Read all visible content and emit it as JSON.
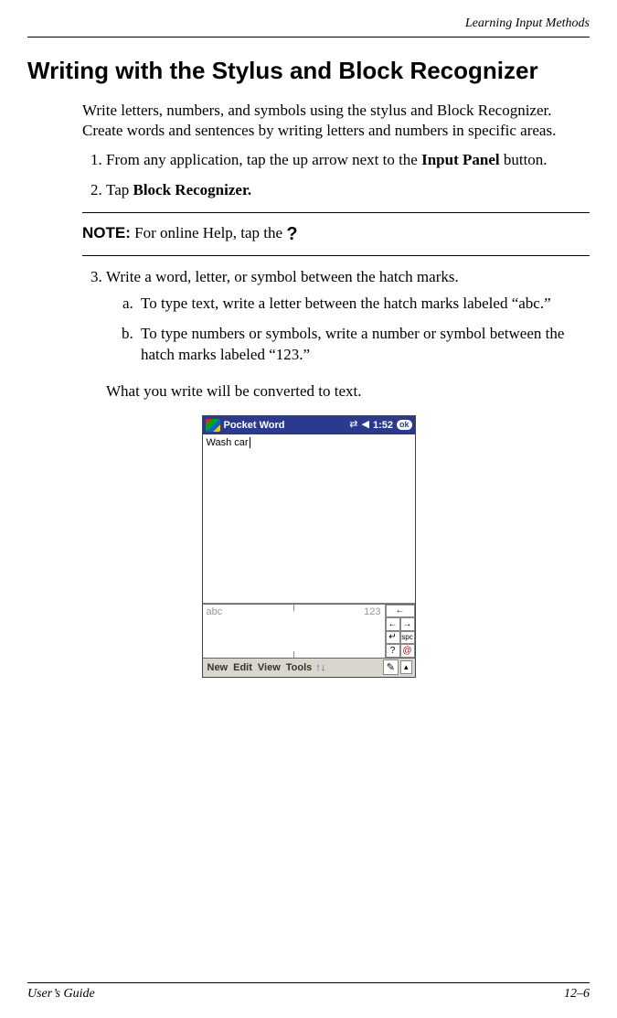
{
  "header": {
    "chapter": "Learning Input Methods"
  },
  "title": "Writing with the Stylus and Block Recognizer",
  "intro": "Write letters, numbers, and symbols using the stylus and Block Recognizer. Create words and sentences by writing letters and numbers in specific areas.",
  "steps": {
    "s1_pre": "From any application, tap the up arrow next to the ",
    "s1_bold": "Input Panel",
    "s1_post": " button.",
    "s2_pre": "Tap ",
    "s2_bold": "Block Recognizer."
  },
  "note": {
    "label": "NOTE:",
    "text": " For online Help, tap the ",
    "icon": "?"
  },
  "step3": {
    "text": "Write a word, letter, or symbol between the hatch marks.",
    "a": "To type text, write a letter between the hatch marks labeled “abc.”",
    "b": "To type numbers or symbols, write a number or symbol between the hatch marks labeled “123.”"
  },
  "closing": "What you write will be converted to text.",
  "device": {
    "app_title": "Pocket Word",
    "time": "1:52",
    "ok": "ok",
    "doc_text": "Wash car",
    "zone_abc": "abc",
    "zone_123": "123",
    "backspace": "←",
    "arrow_left": "←",
    "arrow_right": "→",
    "enter": "↵",
    "spc": "spc",
    "help": "?",
    "at": "@",
    "menu": {
      "new": "New",
      "edit": "Edit",
      "view": "View",
      "tools": "Tools"
    },
    "pen_icon": "✎",
    "up_caret": "▴"
  },
  "footer": {
    "left": "User’s Guide",
    "right": "12–6"
  }
}
